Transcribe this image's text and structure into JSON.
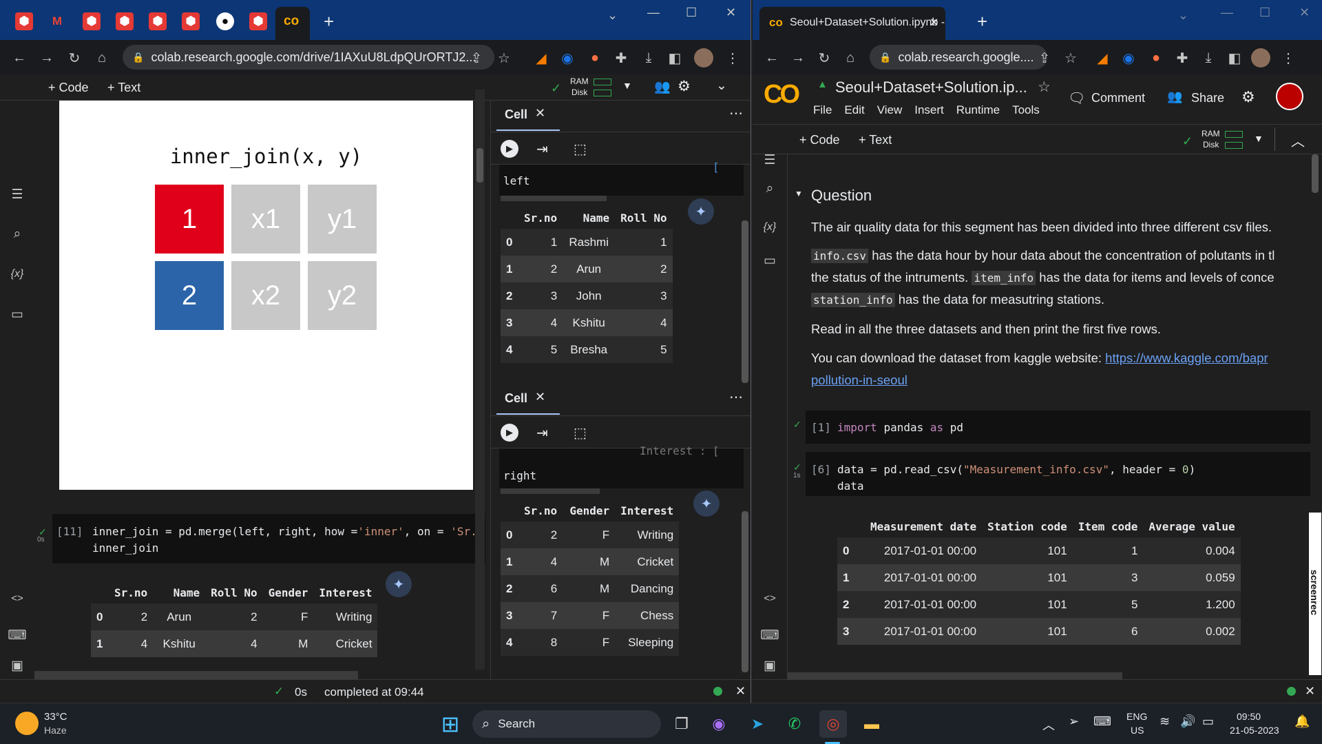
{
  "left_window": {
    "tab_add_label": "+",
    "url": "colab.research.google.com/drive/1IAXuU8LdpQUrORTJ2...",
    "toolbar": {
      "code_label": "+ Code",
      "text_label": "+ Text",
      "ram_label": "RAM",
      "disk_label": "Disk"
    },
    "diagram": {
      "title": "inner_join(x, y)",
      "rows": [
        {
          "key": "1",
          "x": "x1",
          "y": "y1",
          "key_color": "#e0001a"
        },
        {
          "key": "2",
          "x": "x2",
          "y": "y2",
          "key_color": "#2b64a8"
        }
      ]
    },
    "cell11": {
      "prompt": "[11]",
      "time": "0s",
      "line1_a": "inner_join = pd.merge(left, right, how =",
      "line1_str": "'inner'",
      "line1_b": ", on =",
      "line1_str2": "'Sr.n",
      "line2": "inner_join"
    },
    "output_table": {
      "headers": [
        "",
        "Sr.no",
        "Name",
        "Roll No",
        "Gender",
        "Interest"
      ],
      "rows": [
        [
          "0",
          "2",
          "Arun",
          "2",
          "F",
          "Writing"
        ],
        [
          "1",
          "4",
          "Kshitu",
          "4",
          "M",
          "Cricket"
        ]
      ]
    },
    "panel1": {
      "title": "Cell",
      "partial_code": "[",
      "code": "left",
      "table": {
        "headers": [
          "",
          "Sr.no",
          "Name",
          "Roll No"
        ],
        "rows": [
          [
            "0",
            "1",
            "Rashmi",
            "1"
          ],
          [
            "1",
            "2",
            "Arun",
            "2"
          ],
          [
            "2",
            "3",
            "John",
            "3"
          ],
          [
            "3",
            "4",
            "Kshitu",
            "4"
          ],
          [
            "4",
            "5",
            "Bresha",
            "5"
          ]
        ]
      }
    },
    "panel2": {
      "title": "Cell",
      "partial_code": "Interest : [",
      "code": "right",
      "table": {
        "headers": [
          "",
          "Sr.no",
          "Gender",
          "Interest"
        ],
        "rows": [
          [
            "0",
            "2",
            "F",
            "Writing"
          ],
          [
            "1",
            "4",
            "M",
            "Cricket"
          ],
          [
            "2",
            "6",
            "M",
            "Dancing"
          ],
          [
            "3",
            "7",
            "F",
            "Chess"
          ],
          [
            "4",
            "8",
            "F",
            "Sleeping"
          ]
        ]
      }
    },
    "status": {
      "time": "0s",
      "text": "completed at 09:44"
    }
  },
  "right_window": {
    "tab_title": "Seoul+Dataset+Solution.ipynb -",
    "tab_add_label": "+",
    "url": "colab.research.google....",
    "notebook_title": "Seoul+Dataset+Solution.ip...",
    "menu": [
      "File",
      "Edit",
      "View",
      "Insert",
      "Runtime",
      "Tools"
    ],
    "comment_label": "Comment",
    "share_label": "Share",
    "toolbar": {
      "code_label": "+ Code",
      "text_label": "+ Text",
      "ram_label": "RAM",
      "disk_label": "Disk"
    },
    "section_heading": "Question",
    "para1": "The air quality data for this segment has been divided into three different csv files.",
    "para2_code1": "info.csv",
    "para2_a": "has the data hour by hour data about the concentration of polutants in tl",
    "para2_b": "the status of the intruments.",
    "para2_code2": "item_info",
    "para2_c": "has the data for items and levels of conce",
    "para2_code3": "station_info",
    "para2_d": "has the data for measutring stations.",
    "para3": "Read in all the three datasets and then print the first five rows.",
    "para4": "You can download the dataset from kaggle website:",
    "link1": "https://www.kaggle.com/bapr",
    "link2": "pollution-in-seoul",
    "cell1": {
      "prompt": "[1]",
      "kw1": "import",
      "mid": "pandas",
      "kw2": "as",
      "end": "pd"
    },
    "cell6": {
      "prompt": "[6]",
      "time": "1s",
      "line1_a": "data = pd.read_csv(",
      "line1_str": "\"Measurement_info.csv\"",
      "line1_b": ", header =",
      "line1_num": "0",
      "line1_c": ")",
      "line2": "data"
    },
    "output_table": {
      "headers": [
        "",
        "Measurement date",
        "Station code",
        "Item code",
        "Average value"
      ],
      "rows": [
        [
          "0",
          "2017-01-01 00:00",
          "101",
          "1",
          "0.004"
        ],
        [
          "1",
          "2017-01-01 00:00",
          "101",
          "3",
          "0.059"
        ],
        [
          "2",
          "2017-01-01 00:00",
          "101",
          "5",
          "1.200"
        ],
        [
          "3",
          "2017-01-01 00:00",
          "101",
          "6",
          "0.002"
        ]
      ]
    },
    "screenrec_label": "screenrec"
  },
  "taskbar": {
    "weather_temp": "33°C",
    "weather_desc": "Haze",
    "search_label": "Search",
    "lang": "ENG",
    "region": "US",
    "time": "09:50",
    "date": "21-05-2023"
  }
}
